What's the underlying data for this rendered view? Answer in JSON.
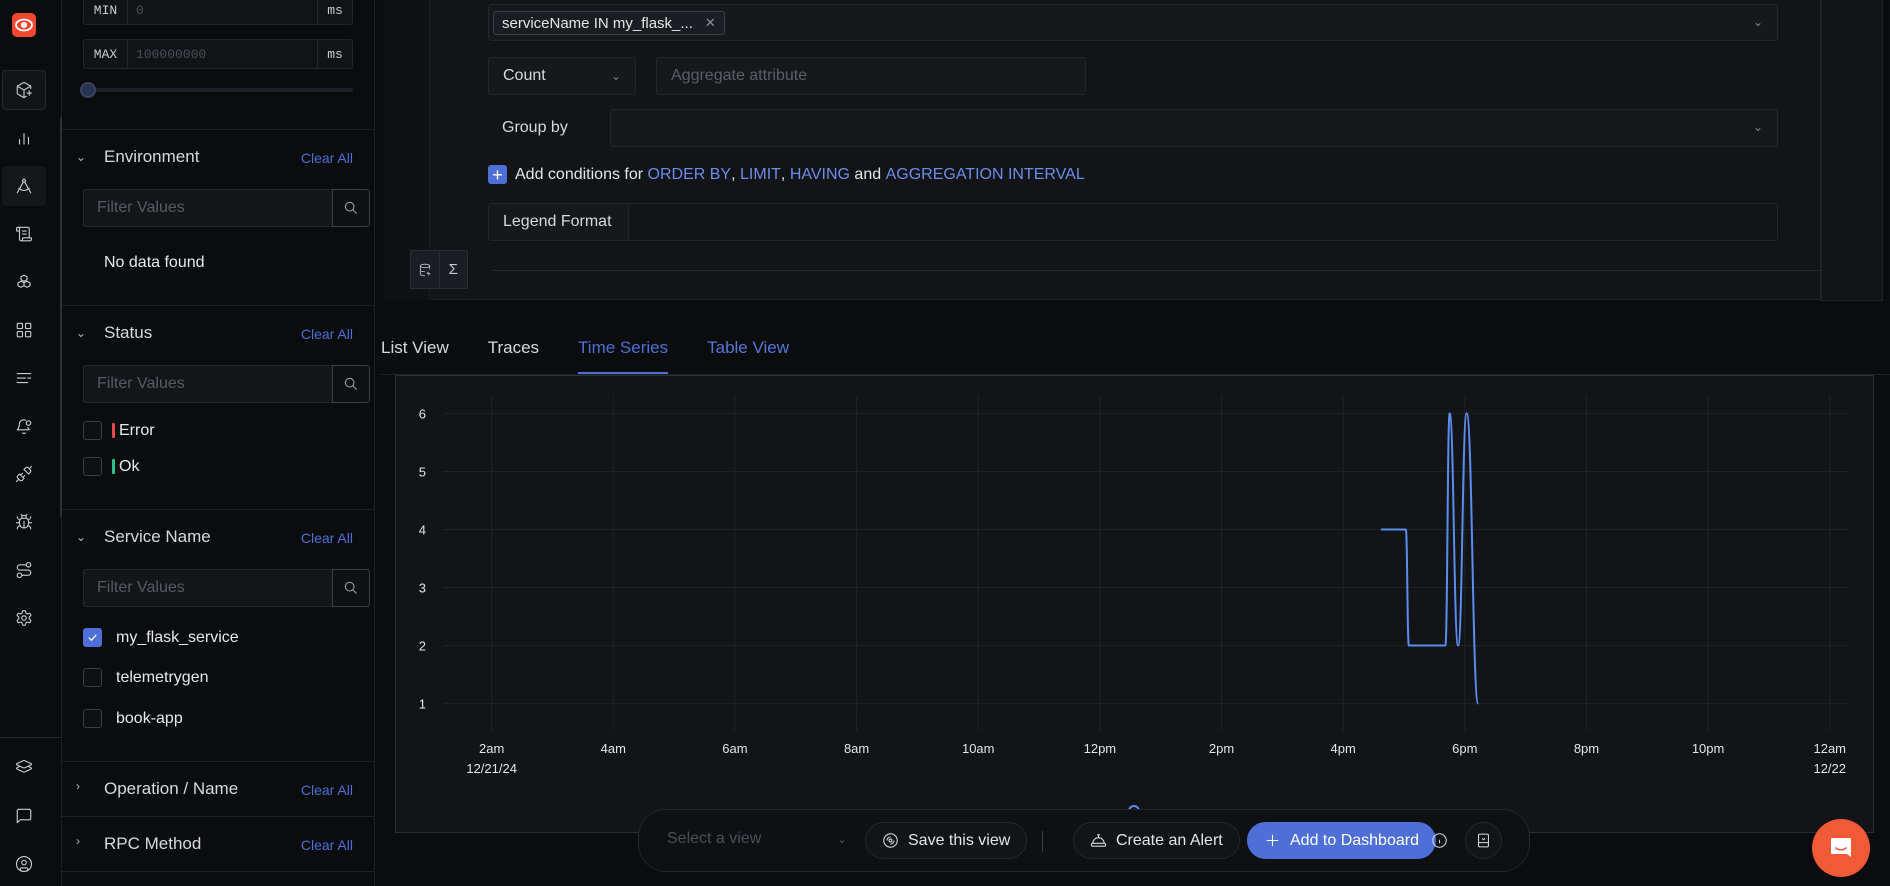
{
  "nav_rail": {
    "logo_icon": "signoz-eye-logo",
    "items": [
      {
        "name": "get-started",
        "icon": "package-plus-icon"
      },
      {
        "name": "services",
        "icon": "bar-chart-icon"
      },
      {
        "name": "traces-explorer",
        "icon": "drafting-compass-icon",
        "active": true
      },
      {
        "name": "logs",
        "icon": "scroll-text-icon"
      },
      {
        "name": "infrastructure",
        "icon": "boxes-icon"
      },
      {
        "name": "dashboards",
        "icon": "layout-grid-icon"
      },
      {
        "name": "messaging-queues",
        "icon": "list-minus-icon"
      },
      {
        "name": "alerts",
        "icon": "bell-dot-icon"
      },
      {
        "name": "integrations",
        "icon": "plug-icon"
      },
      {
        "name": "exceptions",
        "icon": "bug-icon"
      },
      {
        "name": "service-map",
        "icon": "route-icon"
      },
      {
        "name": "settings",
        "icon": "settings-icon"
      }
    ],
    "bottom_items": [
      {
        "name": "layers",
        "icon": "layers-icon"
      },
      {
        "name": "support-chat",
        "icon": "message-square-icon"
      },
      {
        "name": "user-profile",
        "icon": "user-circle-icon"
      }
    ]
  },
  "filters": {
    "duration": {
      "min_label": "MIN",
      "min_placeholder": "0",
      "min_unit": "ms",
      "max_label": "MAX",
      "max_placeholder": "100000000",
      "max_unit": "ms",
      "slider_value_fraction": 0
    },
    "clear_all_label": "Clear All",
    "filter_placeholder": "Filter Values",
    "sections": {
      "environment": {
        "title": "Environment",
        "expanded": true,
        "empty_text": "No data found"
      },
      "status": {
        "title": "Status",
        "expanded": true,
        "options": [
          {
            "label": "Error",
            "color": "#e5484d",
            "checked": false
          },
          {
            "label": "Ok",
            "color": "#25c38a",
            "checked": false
          }
        ]
      },
      "service_name": {
        "title": "Service Name",
        "expanded": true,
        "options": [
          {
            "label": "my_flask_service",
            "checked": true
          },
          {
            "label": "telemetrygen",
            "checked": false
          },
          {
            "label": "book-app",
            "checked": false
          }
        ]
      },
      "operation": {
        "title": "Operation / Name",
        "expanded": false
      },
      "rpc_method": {
        "title": "RPC Method",
        "expanded": false
      }
    }
  },
  "query_builder": {
    "where_chip": "serviceName IN my_flask_...",
    "aggregate_operator": "Count",
    "aggregate_attribute_placeholder": "Aggregate attribute",
    "group_by_label": "Group by",
    "add_conditions": {
      "prefix": "Add conditions for",
      "order_by": "ORDER BY",
      "limit": "LIMIT",
      "having": "HAVING",
      "and": "and",
      "aggregation_interval": "AGGREGATION INTERVAL",
      "sep": ","
    },
    "legend_format_label": "Legend Format",
    "legend_format_value": ""
  },
  "tabs": [
    {
      "label": "List View",
      "active": false
    },
    {
      "label": "Traces",
      "active": false
    },
    {
      "label": "Time Series",
      "active": true
    },
    {
      "label": "Table View",
      "active": false
    }
  ],
  "chart_data": {
    "type": "line",
    "title": "",
    "xlabel": "",
    "ylabel": "",
    "x_unit": "hours since 12/21/24 00:00",
    "xlim": [
      1.2,
      24.3
    ],
    "ylim": [
      0.7,
      6.3
    ],
    "grid": true,
    "x_ticks": [
      {
        "value": 2,
        "label": "2am",
        "sub": "12/21/24"
      },
      {
        "value": 4,
        "label": "4am"
      },
      {
        "value": 6,
        "label": "6am"
      },
      {
        "value": 8,
        "label": "8am"
      },
      {
        "value": 10,
        "label": "10am"
      },
      {
        "value": 12,
        "label": "12pm"
      },
      {
        "value": 14,
        "label": "2pm"
      },
      {
        "value": 16,
        "label": "4pm"
      },
      {
        "value": 18,
        "label": "6pm"
      },
      {
        "value": 20,
        "label": "8pm"
      },
      {
        "value": 22,
        "label": "10pm"
      },
      {
        "value": 24,
        "label": "12am",
        "sub": "12/22"
      }
    ],
    "y_ticks": [
      1,
      2,
      3,
      4,
      5,
      6
    ],
    "series": [
      {
        "name": "",
        "color": "#5b8def",
        "x": [
          16.62,
          17.03,
          17.08,
          17.68,
          17.75,
          17.89,
          18.03,
          18.22
        ],
        "values": [
          4,
          4,
          2,
          2,
          6,
          2,
          6,
          1
        ]
      }
    ],
    "legend": "bottom-center"
  },
  "toolbar": {
    "select_view_placeholder": "Select a view",
    "save_view_label": "Save this view",
    "create_alert_label": "Create an Alert",
    "add_dashboard_label": "Add to Dashboard"
  },
  "colors": {
    "accent": "#4e6fd8",
    "brand": "#f0472f",
    "chat_fab": "#f05a36"
  }
}
